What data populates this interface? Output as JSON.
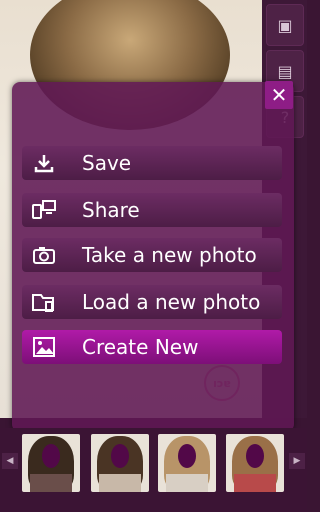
{
  "menu": {
    "items": [
      {
        "label": "Save",
        "icon": "download-icon",
        "active": false
      },
      {
        "label": "Share",
        "icon": "share-devices-icon",
        "active": false
      },
      {
        "label": "Take a new photo",
        "icon": "camera-icon",
        "active": false
      },
      {
        "label": "Load a new photo",
        "icon": "folder-icon",
        "active": false
      },
      {
        "label": "Create New",
        "icon": "image-icon",
        "active": true
      }
    ],
    "close_icon": "close-icon"
  },
  "sidebar": {
    "help_label": "?"
  },
  "colors": {
    "overlay": "#601854",
    "active": "#b01aa8",
    "close": "#8e1d86"
  }
}
